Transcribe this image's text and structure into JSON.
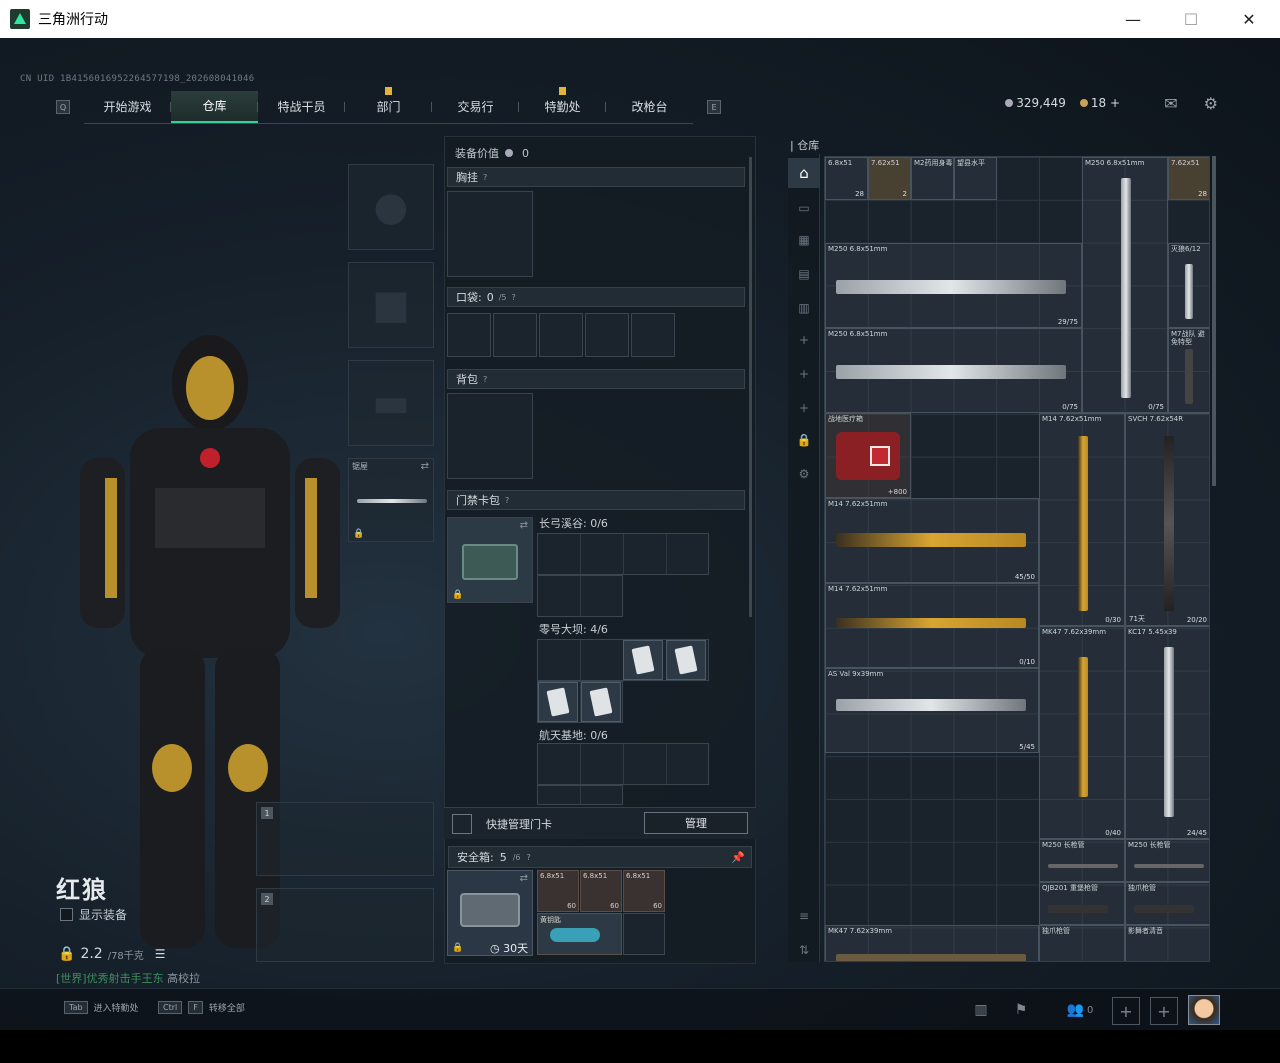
{
  "window": {
    "title": "三角洲行动",
    "minimize": "—",
    "maximize": "☐",
    "close": "✕"
  },
  "uid": "CN UID 1B4156016952264577198_202608041046",
  "nav": {
    "left_key": "Q",
    "right_key": "E",
    "tabs": [
      "开始游戏",
      "仓库",
      "特战干员",
      "部门",
      "交易行",
      "特勤处",
      "改枪台"
    ],
    "active_index": 1,
    "badge_tabs": [
      3,
      5
    ]
  },
  "currency": {
    "coins": "329,449",
    "premium": "18",
    "premium_add": "+"
  },
  "header_icons": [
    "mail-icon",
    "settings-icon"
  ],
  "character": {
    "name": "红狼",
    "show_equipment": "显示装备",
    "weight": "2.2",
    "weight_max": "/78千克",
    "world_prefix": "[世界]",
    "world_text": "优秀射击手王东",
    "world_suffix": "高校拉",
    "melee_label": "锯屋",
    "weapon_slots": [
      "1",
      "2"
    ]
  },
  "loadout": {
    "value_label": "装备价值",
    "value": "0",
    "chest": "胸挂",
    "pockets_label": "口袋:",
    "pockets_used": "0",
    "pockets_max": "/5",
    "backpack": "背包",
    "keycard": "门禁卡包",
    "maps": [
      {
        "label": "长弓溪谷: 0/6"
      },
      {
        "label": "零号大坝: 4/6"
      },
      {
        "label": "航天基地: 0/6"
      }
    ],
    "quick_manage": "快捷管理门卡",
    "manage_button": "管理",
    "safe_label": "安全箱:",
    "safe_used": "5",
    "safe_max": "/6",
    "safe_days": "30天",
    "safe_items": [
      {
        "name": "6.8x51",
        "count": "60"
      },
      {
        "name": "6.8x51",
        "count": "60"
      },
      {
        "name": "6.8x51",
        "count": "60"
      },
      {
        "name": "黄钥匙",
        "count": ""
      }
    ]
  },
  "warehouse": {
    "title": "仓库",
    "items": [
      {
        "name": "6.8x51",
        "count": "28"
      },
      {
        "name": "7.62x51",
        "count": "2"
      },
      {
        "name": "M2药用身毒",
        "count": ""
      },
      {
        "name": "望县水平",
        "count": ""
      },
      {
        "name": "M250\n6.8x51mm",
        "count": ""
      },
      {
        "name": "7.62x51",
        "count": "28"
      },
      {
        "name": "M250\n6.8x51mm",
        "count": "29/75"
      },
      {
        "name": "灭狼6/12",
        "count": ""
      },
      {
        "name": "M250\n6.8x51mm",
        "count": "0/75"
      },
      {
        "name": "",
        "count": "0/75"
      },
      {
        "name": "M7战队\n避免特型",
        "count": ""
      },
      {
        "name": "战地医疗箱",
        "count": "+800"
      },
      {
        "name": "M14\n7.62x51mm",
        "count": "0/30"
      },
      {
        "name": "SVCH\n7.62x54R",
        "count": "20/20"
      },
      {
        "name": "71天",
        "count": "5/20"
      },
      {
        "name": "M14\n7.62x51mm",
        "count": "45/50"
      },
      {
        "name": "M14\n7.62x51mm",
        "count": "0/10"
      },
      {
        "name": "MK47\n7.62x39mm",
        "count": ""
      },
      {
        "name": "KC17\n5.45x39",
        "count": ""
      },
      {
        "name": "AS Val\n9x39mm",
        "count": "5/45"
      },
      {
        "name": "",
        "count": "0/40"
      },
      {
        "name": "",
        "count": "24/45"
      },
      {
        "name": "M250\n长枪管",
        "count": ""
      },
      {
        "name": "M250\n长枪管",
        "count": ""
      },
      {
        "name": "QJB201\n重堡枪管",
        "count": ""
      },
      {
        "name": "独爪枪管",
        "count": ""
      },
      {
        "name": "MK47\n7.62x39mm",
        "count": ""
      },
      {
        "name": "独爪枪管",
        "count": ""
      },
      {
        "name": "影舞者清音",
        "count": ""
      }
    ]
  },
  "bottom": {
    "hint1_key": "Tab",
    "hint1": "进入特勤处",
    "hint2_key1": "Ctrl",
    "hint2_key2": "F",
    "hint2": "转移全部",
    "friends": "0"
  },
  "colors": {
    "accent": "#2fd39a",
    "badge": "#e0b53a",
    "gold": "#d9a532"
  }
}
